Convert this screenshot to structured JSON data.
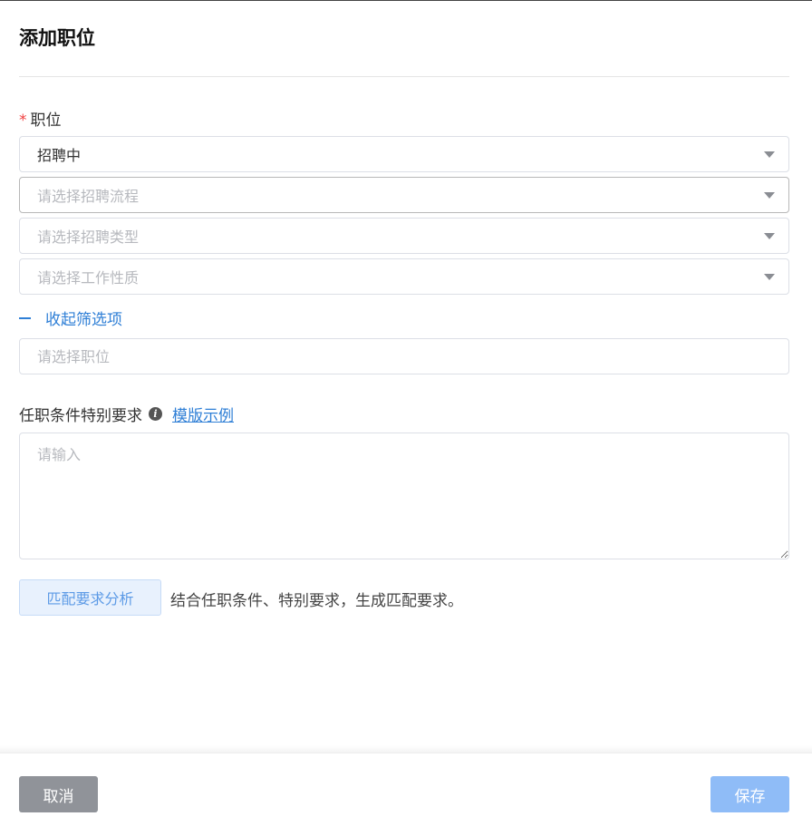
{
  "dialog": {
    "title": "添加职位"
  },
  "position_field": {
    "required_mark": "*",
    "label": "职位",
    "status_select": {
      "value": "招聘中"
    },
    "process_select": {
      "placeholder": "请选择招聘流程"
    },
    "type_select": {
      "placeholder": "请选择招聘类型"
    },
    "nature_select": {
      "placeholder": "请选择工作性质"
    },
    "collapse_label": "收起筛选项",
    "position_input": {
      "placeholder": "请选择职位"
    }
  },
  "requirements": {
    "label": "任职条件特别要求",
    "info_icon": "i",
    "template_link": "模版示例",
    "textarea_placeholder": "请输入"
  },
  "match": {
    "button_label": "匹配要求分析",
    "description": "结合任职条件、特别要求，生成匹配要求。"
  },
  "footer": {
    "cancel_label": "取消",
    "save_label": "保存"
  },
  "colors": {
    "accent": "#2f7fd6",
    "required": "#f04040",
    "cancel_bg": "#909399",
    "save_bg": "#8fbcf7"
  }
}
